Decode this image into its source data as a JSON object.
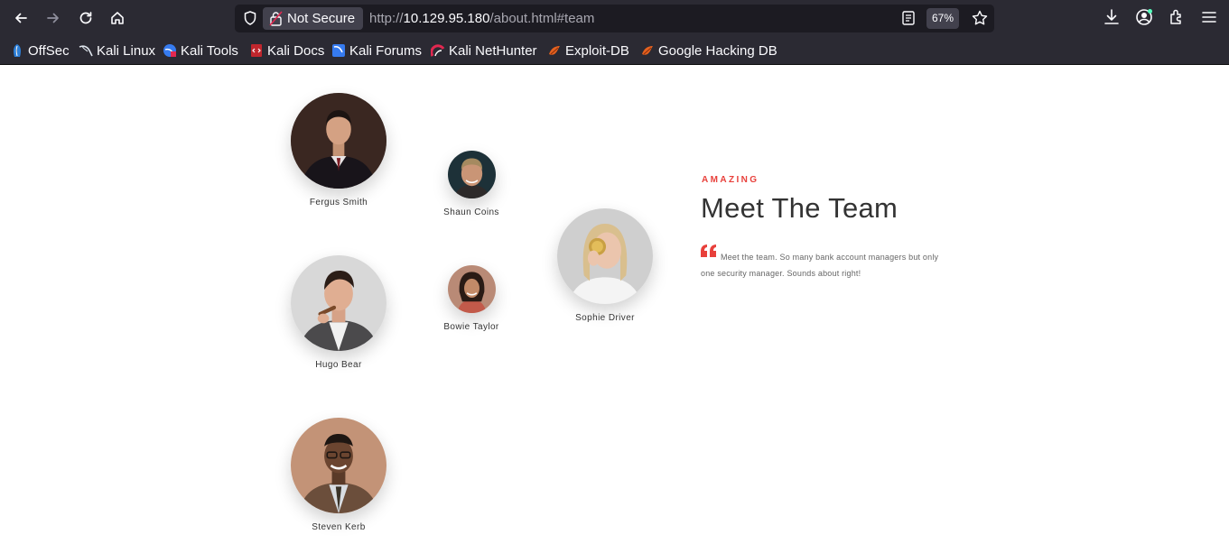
{
  "browser": {
    "security_label": "Not Secure",
    "url_prefix": "http://",
    "url_host": "10.129.95.180",
    "url_path": "/about.html#team",
    "zoom": "67%",
    "icons": [
      "back-icon",
      "forward-icon",
      "reload-icon",
      "home-icon",
      "shield-icon",
      "lock-icon",
      "reader-icon",
      "star-icon",
      "download-icon",
      "account-icon",
      "extensions-icon",
      "menu-icon"
    ]
  },
  "bookmarks": [
    {
      "label": "OffSec",
      "icon": "offsec-icon"
    },
    {
      "label": "Kali Linux",
      "icon": "kali-icon"
    },
    {
      "label": "Kali Tools",
      "icon": "kali-tools-icon"
    },
    {
      "label": "Kali Docs",
      "icon": "kali-docs-icon"
    },
    {
      "label": "Kali Forums",
      "icon": "kali-forums-icon"
    },
    {
      "label": "Kali NetHunter",
      "icon": "nethunter-icon"
    },
    {
      "label": "Exploit-DB",
      "icon": "exploitdb-icon"
    },
    {
      "label": "Google Hacking DB",
      "icon": "ghdb-icon"
    }
  ],
  "team_section": {
    "eyebrow": "AMAZING",
    "title": "Meet The Team",
    "quote": "Meet the team. So many bank account managers but only one security manager. Sounds about right!",
    "accent_color": "#e8403b",
    "members": [
      {
        "name": "Fergus Smith"
      },
      {
        "name": "Shaun Coins"
      },
      {
        "name": "Hugo Bear"
      },
      {
        "name": "Bowie Taylor"
      },
      {
        "name": "Sophie Driver"
      },
      {
        "name": "Steven Kerb"
      }
    ]
  }
}
